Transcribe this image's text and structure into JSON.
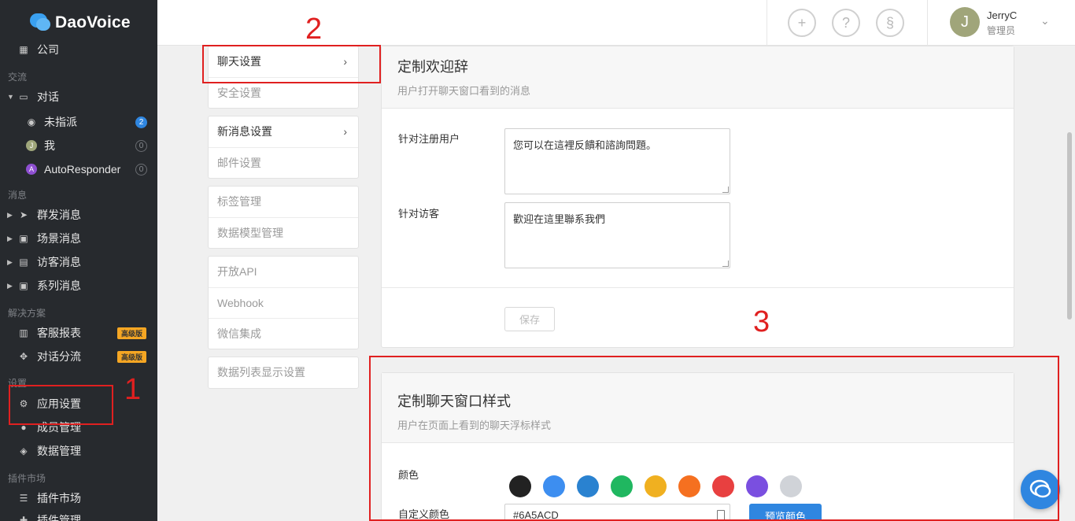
{
  "brand": {
    "name": "DaoVoice",
    "color": "#3aa0f0"
  },
  "sidebar": {
    "company_label": "公司",
    "groups": {
      "exchange": "交流",
      "messages": "消息",
      "solutions": "解决方案",
      "settings": "设置",
      "plugins": "插件市场"
    },
    "conversation": {
      "label": "对话",
      "children": [
        {
          "label": "未指派",
          "badge": "2"
        },
        {
          "label": "我",
          "badge": "0",
          "avatar": "J"
        },
        {
          "label": "AutoResponder",
          "badge": "0",
          "avatar": "A"
        }
      ]
    },
    "message_items": [
      "群发消息",
      "场景消息",
      "访客消息",
      "系列消息"
    ],
    "solution_items": [
      {
        "label": "客服报表",
        "tag": "高级版"
      },
      {
        "label": "对话分流",
        "tag": "高级版"
      }
    ],
    "settings_items": [
      "应用设置",
      "成员管理",
      "数据管理"
    ],
    "plugin_items": [
      "插件市场",
      "插件管理"
    ]
  },
  "header": {
    "user_initial": "J",
    "user_name": "JerryC",
    "user_role": "管理员"
  },
  "settings_menu": {
    "group1": [
      "聊天设置",
      "安全设置"
    ],
    "group2": [
      "新消息设置",
      "邮件设置"
    ],
    "group3": [
      "标签管理",
      "数据模型管理"
    ],
    "group4": [
      "开放API",
      "Webhook",
      "微信集成"
    ],
    "group5": [
      "数据列表显示设置"
    ]
  },
  "welcome_panel": {
    "title": "定制欢迎辞",
    "subtitle": "用户打开聊天窗口看到的消息",
    "registered_label": "针对注册用户",
    "registered_value": "您可以在這裡反饋和諮詢問題。",
    "visitor_label": "针对访客",
    "visitor_value": "歡迎在這里聯系我們",
    "save_label": "保存"
  },
  "style_panel": {
    "title": "定制聊天窗口样式",
    "subtitle": "用户在页面上看到的聊天浮标样式",
    "color_label": "颜色",
    "swatches": [
      "#222222",
      "#3d8ef0",
      "#2a82d0",
      "#20b760",
      "#f0b020",
      "#f57020",
      "#e84040",
      "#7a4fe0",
      "#d0d3d8"
    ],
    "custom_color_label": "自定义颜色",
    "custom_color_value": "#6A5ACD",
    "preview_label": "预览颜色"
  },
  "annotations": {
    "one": "1",
    "two": "2",
    "three": "3",
    "color": "#e02020"
  }
}
